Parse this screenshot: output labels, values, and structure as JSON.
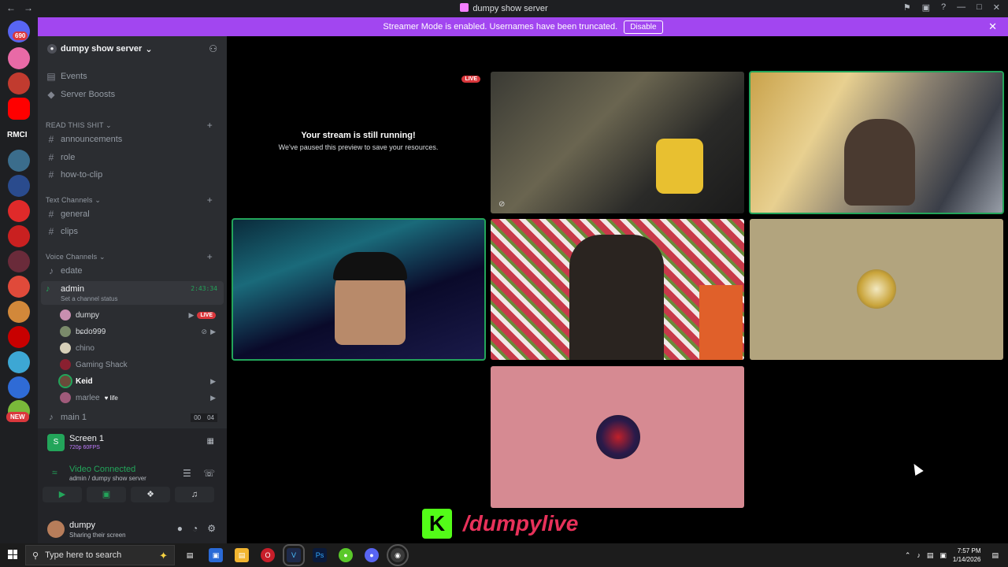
{
  "window": {
    "title": "dumpy show server"
  },
  "banner": {
    "text": "Streamer Mode is enabled. Usernames have been truncated.",
    "disable_label": "Disable"
  },
  "guilds": {
    "notification_count": "690",
    "rmci_label": "RMCI",
    "new_label": "NEW"
  },
  "server": {
    "name": "dumpy show server",
    "top_items": [
      "Events",
      "Server Boosts"
    ],
    "category_1": "READ THIS SHIT",
    "read_channels": [
      "announcements",
      "role",
      "how-to-clip"
    ],
    "category_2": "Text Channels",
    "text_channels": [
      "general",
      "clips"
    ],
    "category_3": "Voice Channels",
    "voice_channels": [
      "edate"
    ],
    "active_voice": {
      "name": "admin",
      "status": "Set a channel status",
      "timer": "2:43:34"
    },
    "members": [
      {
        "name": "dumpy",
        "badge": "LIVE"
      },
      {
        "name": "bɕdo999"
      },
      {
        "name": "chino"
      },
      {
        "name": "Gaming Shack"
      },
      {
        "name": "Keid"
      },
      {
        "name": "marlee",
        "tag": "life"
      }
    ],
    "main1": {
      "name": "main 1",
      "counts": [
        "00",
        "04"
      ]
    }
  },
  "panel": {
    "screen_title": "Screen 1",
    "screen_quality": "720p 60FPS",
    "connection_status": "Video Connected",
    "connection_location": "admin / dumpy show server"
  },
  "user": {
    "name": "dumpy",
    "status": "Sharing their screen"
  },
  "stage": {
    "paused_title": "Your stream is still running!",
    "paused_sub": "We've paused this preview to save your resources.",
    "live_label": "LIVE"
  },
  "overlay": {
    "kick_handle": "/dumpylive",
    "kick_logo": "K"
  },
  "taskbar": {
    "search_placeholder": "Type here to search",
    "time": "7:57 PM",
    "date": "1/14/2026"
  },
  "colors": {
    "accent": "#a246f0",
    "speaking": "#23a55a",
    "live": "#da373c",
    "kick": "#53fc18"
  }
}
